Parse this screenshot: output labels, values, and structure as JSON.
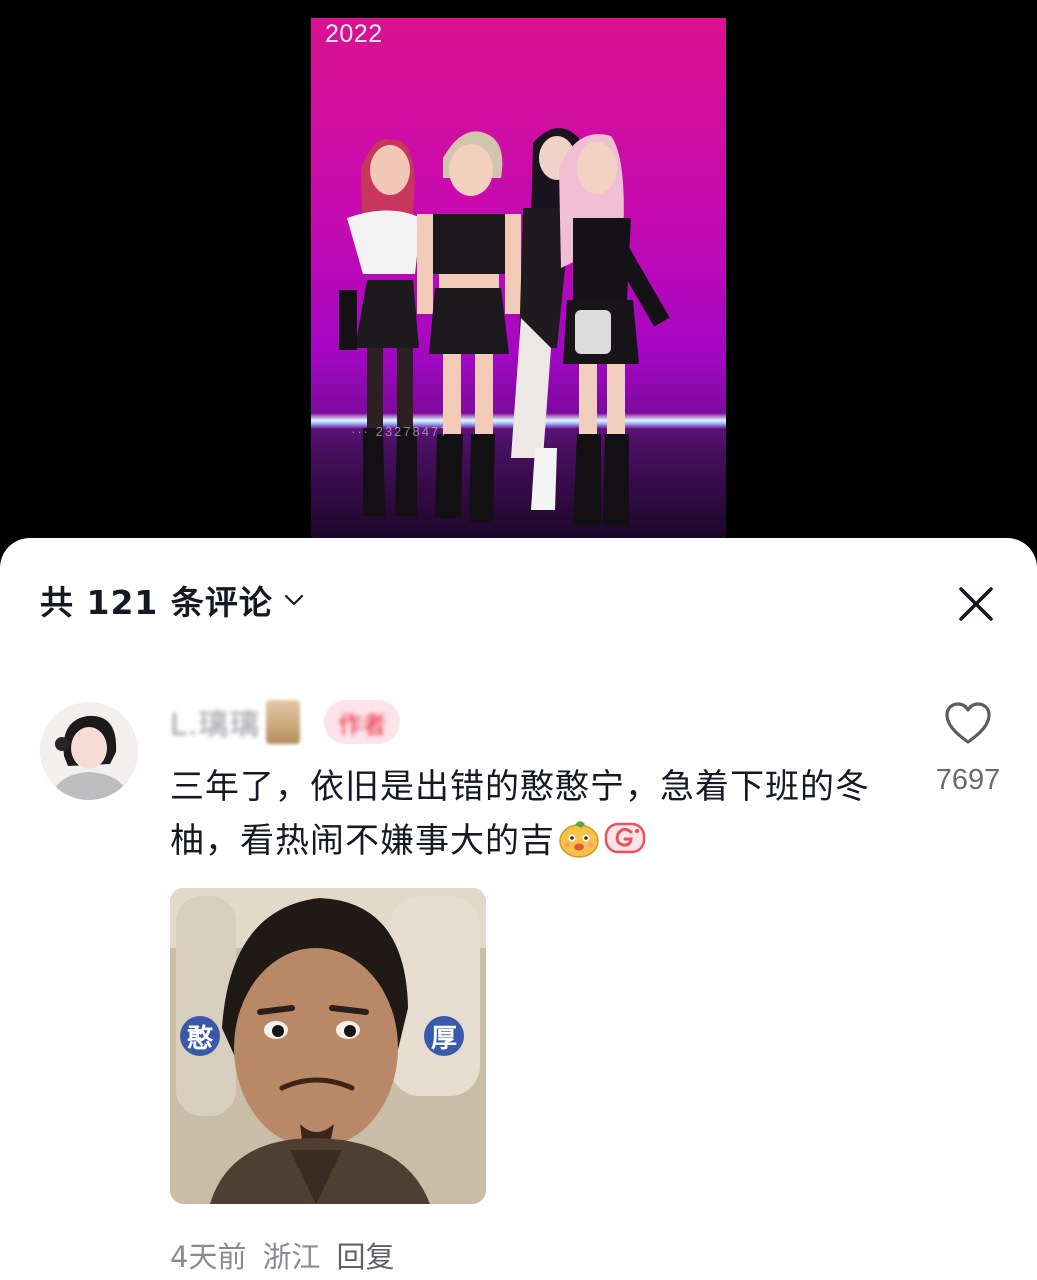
{
  "video": {
    "year_label": "2022",
    "watermark": "··· 23278477"
  },
  "comments_panel": {
    "title": "共 121 条评论",
    "dropdown_icon": "chevron-down-icon",
    "close_icon": "close-icon"
  },
  "comment": {
    "username": "L.璃璃",
    "author_tag": "作者",
    "text": "三年了，依旧是出错的憨憨宁，急着下班的冬柚，看热闹不嫌事大的吉",
    "emojis": [
      "orange-face-emoji",
      "good-sticker-emoji"
    ],
    "image_labels": {
      "left": "憨",
      "right": "厚"
    },
    "like_count": "7697",
    "time": "4天前",
    "location": "浙江",
    "reply_label": "回复"
  }
}
